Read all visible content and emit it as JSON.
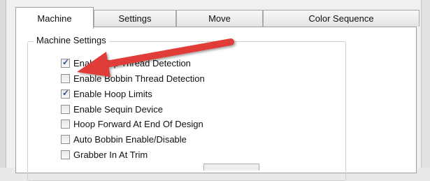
{
  "tabs": [
    {
      "label": "Machine",
      "active": true
    },
    {
      "label": "Settings",
      "active": false
    },
    {
      "label": "Move",
      "active": false
    },
    {
      "label": "Color Sequence",
      "active": false
    }
  ],
  "group": {
    "title": "Machine Settings",
    "options": [
      {
        "label": "Enable Top Thread Detection",
        "checked": true
      },
      {
        "label": "Enable Bobbin Thread Detection",
        "checked": false
      },
      {
        "label": "Enable Hoop Limits",
        "checked": true
      },
      {
        "label": "Enable Sequin Device",
        "checked": false
      },
      {
        "label": "Hoop Forward At End Of Design",
        "checked": false
      },
      {
        "label": "Auto Bobbin Enable/Disable",
        "checked": false
      },
      {
        "label": "Grabber In At Trim",
        "checked": false
      }
    ]
  },
  "annotation": {
    "arrow_color": "#e03c37"
  }
}
